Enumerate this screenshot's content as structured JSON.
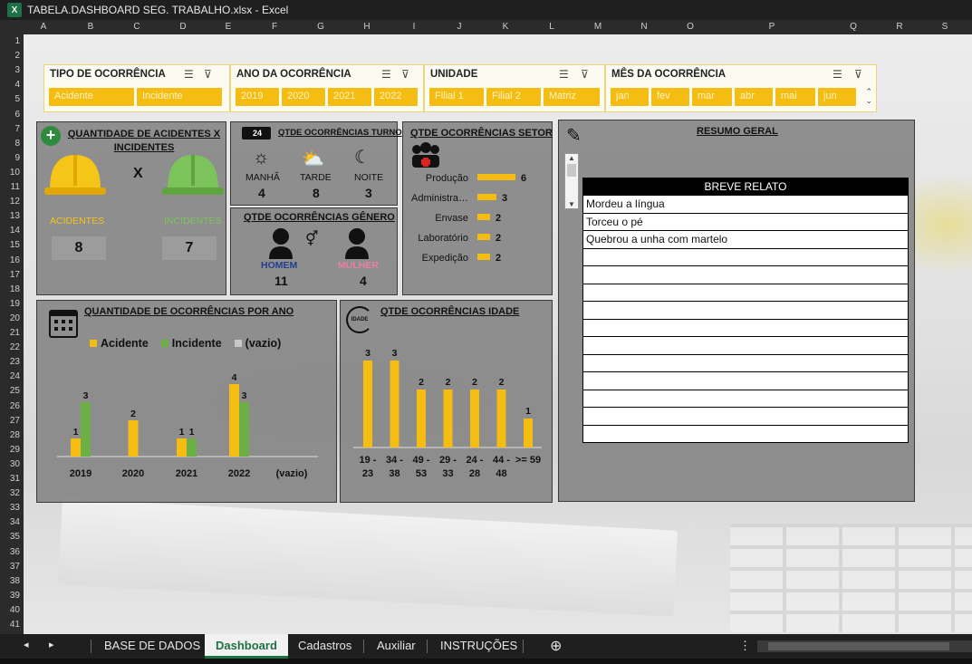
{
  "window": {
    "title": "TABELA.DASHBOARD SEG. TRABALHO.xlsx - Excel",
    "app_icon": "X"
  },
  "columns": [
    "A",
    "B",
    "C",
    "D",
    "E",
    "F",
    "G",
    "H",
    "I",
    "J",
    "K",
    "L",
    "M",
    "N",
    "O",
    "P",
    "Q",
    "R",
    "S"
  ],
  "rows": [
    "1",
    "2",
    "3",
    "4",
    "5",
    "6",
    "7",
    "8",
    "9",
    "10",
    "11",
    "12",
    "13",
    "14",
    "15",
    "16",
    "17",
    "18",
    "19",
    "20",
    "21",
    "22",
    "23",
    "24",
    "25",
    "26",
    "27",
    "28",
    "29",
    "30",
    "31",
    "32",
    "33",
    "34",
    "35",
    "36",
    "37",
    "38",
    "39",
    "40",
    "41"
  ],
  "slicers": {
    "tipo": {
      "title": "TIPO DE OCORRÊNCIA",
      "items": [
        "Acidente",
        "Incidente"
      ]
    },
    "ano": {
      "title": "ANO DA OCORRÊNCIA",
      "items": [
        "2019",
        "2020",
        "2021",
        "2022"
      ]
    },
    "unidade": {
      "title": "UNIDADE",
      "items": [
        "Filial 1",
        "Filial 2",
        "Matriz"
      ]
    },
    "mes": {
      "title": "MÊS DA OCORRÊNCIA",
      "items": [
        "jan",
        "fev",
        "mar",
        "abr",
        "mai",
        "jun"
      ]
    }
  },
  "acidentes_incidentes": {
    "title": "QUANTIDADE DE ACIDENTES X INCIDENTES",
    "vs": "X",
    "acidentes_label": "ACIDENTES",
    "incidentes_label": "INCIDENTES",
    "acidentes_value": "8",
    "incidentes_value": "7",
    "colors": {
      "acidente": "#f5c518",
      "incidente": "#7dc35b"
    }
  },
  "turno": {
    "title": "QTDE OCORRÊNCIAS TURNO",
    "clock_badge": "24",
    "items": [
      {
        "label": "MANHÃ",
        "value": "4"
      },
      {
        "label": "TARDE",
        "value": "8"
      },
      {
        "label": "NOITE",
        "value": "3"
      }
    ]
  },
  "genero": {
    "title": "QTDE OCORRÊNCIAS GÊNERO",
    "homem_label": "HOMEM",
    "mulher_label": "MULHER",
    "homem_value": "11",
    "mulher_value": "4",
    "colors": {
      "homem": "#1f3f8f",
      "mulher": "#e87ea0"
    }
  },
  "setor": {
    "title": "QTDE OCORRÊNCIAS SETOR",
    "chart_data": {
      "type": "bar",
      "categories": [
        "Produção",
        "Administra…",
        "Envase",
        "Laboratório",
        "Expedição"
      ],
      "values": [
        6,
        3,
        2,
        2,
        2
      ],
      "title": "QTDE OCORRÊNCIAS SETOR",
      "color": "#f5bd12"
    }
  },
  "resumo": {
    "title": "RESUMO GERAL",
    "table_header": "BREVE RELATO",
    "entries": [
      "Mordeu a língua",
      "Torceu o pé",
      "Quebrou a unha com martelo",
      "",
      "",
      "",
      "",
      "",
      "",
      "",
      "",
      "",
      "",
      ""
    ]
  },
  "por_ano": {
    "title": "QUANTIDADE DE OCORRÊNCIAS POR ANO",
    "chart_data": {
      "type": "bar",
      "categories": [
        "2019",
        "2020",
        "2021",
        "2022",
        "(vazio)"
      ],
      "series": [
        {
          "name": "Acidente",
          "values": [
            1,
            2,
            1,
            4,
            null
          ],
          "color": "#f5bd12"
        },
        {
          "name": "Incidente",
          "values": [
            3,
            null,
            1,
            3,
            null
          ],
          "color": "#6cb045"
        },
        {
          "name": "(vazio)",
          "values": [
            null,
            null,
            null,
            null,
            null
          ],
          "color": "#c8c8c8"
        }
      ],
      "ylim": [
        0,
        4
      ]
    }
  },
  "idade": {
    "title": "QTDE OCORRÊNCIAS IDADE",
    "badge": "IDADE",
    "chart_data": {
      "type": "bar",
      "categories": [
        "19 - 23",
        "34 - 38",
        "49 - 53",
        "29 - 33",
        "24 - 28",
        "44 - 48",
        ">= 59"
      ],
      "values": [
        3,
        3,
        2,
        2,
        2,
        2,
        1
      ],
      "color": "#f5bd12",
      "ylim": [
        0,
        3
      ]
    }
  },
  "tabs": [
    "BASE DE DADOS",
    "Dashboard",
    "Cadastros",
    "Auxiliar",
    "INSTRUÇÕES"
  ],
  "active_tab": "Dashboard"
}
